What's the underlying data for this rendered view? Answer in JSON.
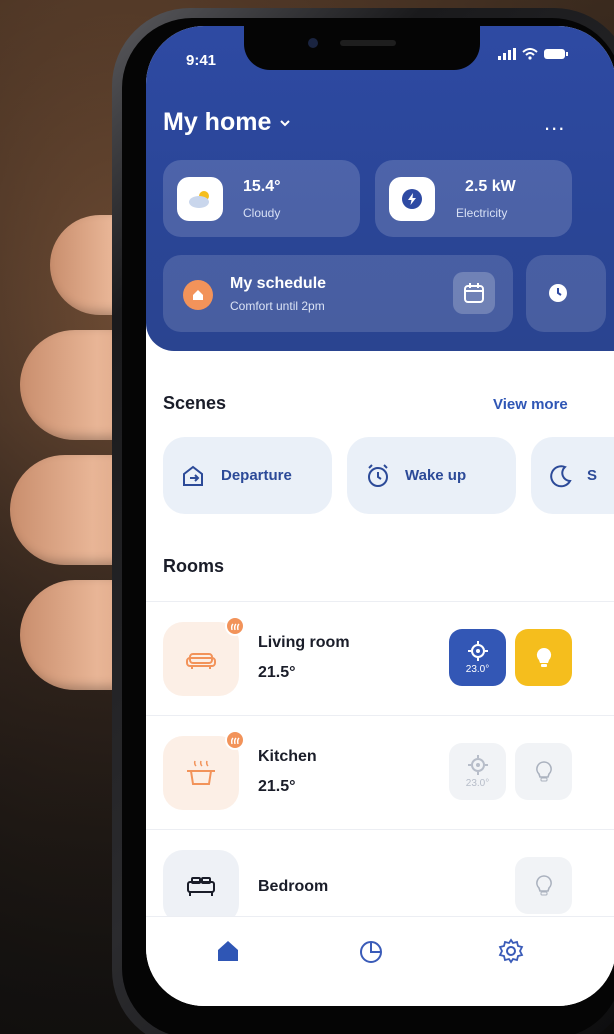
{
  "status_bar": {
    "time": "9:41"
  },
  "header": {
    "title": "My home",
    "more": "..."
  },
  "weather": {
    "value": "15.4°",
    "label": "Cloudy"
  },
  "electricity": {
    "value": "2.5 kW",
    "label": "Electricity"
  },
  "schedule": {
    "title": "My schedule",
    "subtitle": "Comfort until 2pm"
  },
  "scenes": {
    "title": "Scenes",
    "view_more": "View more",
    "items": [
      {
        "label": "Departure",
        "icon": "departure-icon"
      },
      {
        "label": "Wake up",
        "icon": "alarm-clock-icon"
      },
      {
        "label": "S",
        "icon": "moon-icon"
      }
    ]
  },
  "rooms": {
    "title": "Rooms",
    "items": [
      {
        "name": "Living room",
        "temp": "21.5°",
        "thermostat": "23.0°",
        "heating": true,
        "light_on": true
      },
      {
        "name": "Kitchen",
        "temp": "21.5°",
        "thermostat": "23.0°",
        "heating": true,
        "light_on": false
      },
      {
        "name": "Bedroom",
        "temp": "",
        "light_on": false
      }
    ]
  },
  "tabs": [
    "home-icon",
    "stats-icon",
    "settings-icon"
  ],
  "colors": {
    "primary": "#2e4aa3",
    "accent": "#f2935a",
    "light_on": "#f5be1d",
    "scene_bg": "#eaf0f8"
  }
}
